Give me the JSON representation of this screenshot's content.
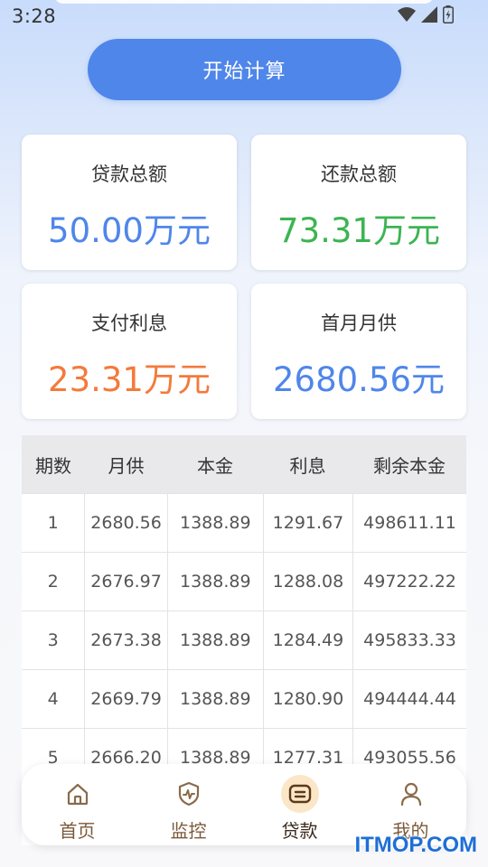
{
  "status_bar": {
    "time": "3:28",
    "icons": [
      "wifi-icon",
      "signal-icon",
      "battery-charging-icon"
    ]
  },
  "start_button": {
    "label": "开始计算"
  },
  "summary": {
    "loan_total": {
      "label": "贷款总额",
      "value": "50.00万元"
    },
    "repay_total": {
      "label": "还款总额",
      "value": "73.31万元"
    },
    "interest": {
      "label": "支付利息",
      "value": "23.31万元"
    },
    "first_month": {
      "label": "首月月供",
      "value": "2680.56元"
    }
  },
  "colors": {
    "accent_blue": "#4f86ea",
    "green": "#3db453",
    "orange": "#f47a3b"
  },
  "table": {
    "headers": [
      "期数",
      "月供",
      "本金",
      "利息",
      "剩余本金"
    ],
    "rows": [
      [
        "1",
        "2680.56",
        "1388.89",
        "1291.67",
        "498611.11"
      ],
      [
        "2",
        "2676.97",
        "1388.89",
        "1288.08",
        "497222.22"
      ],
      [
        "3",
        "2673.38",
        "1388.89",
        "1284.49",
        "495833.33"
      ],
      [
        "4",
        "2669.79",
        "1388.89",
        "1280.90",
        "494444.44"
      ],
      [
        "5",
        "2666.20",
        "1388.89",
        "1277.31",
        "493055.56"
      ]
    ]
  },
  "nav": {
    "items": [
      {
        "label": "首页",
        "icon": "home-icon",
        "active": false
      },
      {
        "label": "监控",
        "icon": "shield-icon",
        "active": false
      },
      {
        "label": "贷款",
        "icon": "loan-icon",
        "active": true
      },
      {
        "label": "我的",
        "icon": "user-icon",
        "active": false
      }
    ]
  },
  "watermark": "ITMOP.COM"
}
